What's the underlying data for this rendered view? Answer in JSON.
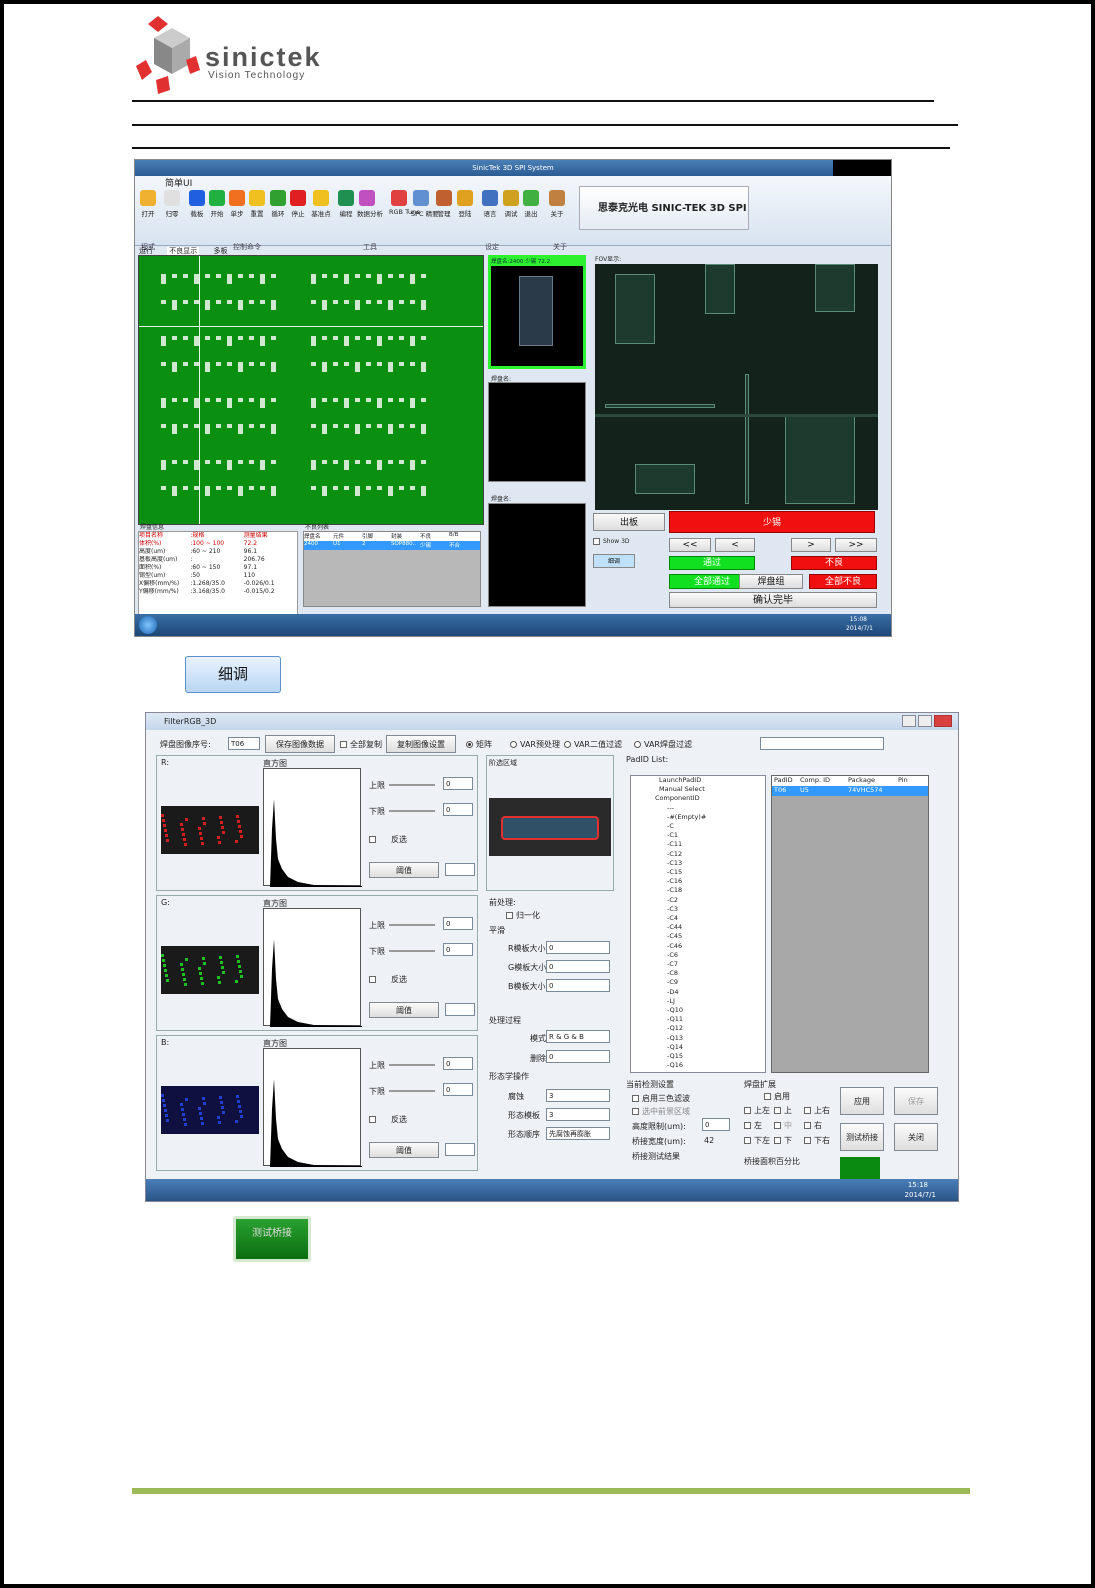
{
  "logo": {
    "name": "sinictek",
    "tagline": "Vision Technology"
  },
  "shot1": {
    "title": "SinicTek 3D SPI System",
    "tab_main": "简单UI",
    "ribbon_buttons": [
      "打开",
      "归零",
      "载板",
      "开始",
      "单步",
      "重置",
      "循环",
      "停止",
      "基准点",
      "编程",
      "数据分析",
      "RGB Tune",
      "SPC 精要",
      "管理",
      "登陆",
      "语言",
      "调试",
      "退出",
      "关于"
    ],
    "group_labels": [
      "程式",
      "控制命令",
      "工具",
      "",
      "设定",
      "关于"
    ],
    "brand_banner": "思泰克光电 SINIC-TEK 3D SPI",
    "tabs": [
      "运行",
      "不良显示",
      "多板"
    ],
    "thumb_label": "焊盘名:2400 少锡 72.2",
    "pad_name_label_1": "焊盘名:",
    "pad_name_label_2": "焊盘名:",
    "fov_label": "FOV显示:",
    "result_banner": "少锡",
    "exit_board": "出板",
    "show3d": "Show 3D",
    "detail": "细调",
    "nav": [
      "<<",
      "<",
      ">",
      ">>"
    ],
    "pass": "通过",
    "fail": "不良",
    "all_pass": "全部通过",
    "pad_group": "焊盘组",
    "all_fail": "全部不良",
    "confirm": "确认完毕",
    "pad_info_title": "焊盘信息",
    "pad_info_header": [
      "项目名称",
      ":规格",
      "测量结果"
    ],
    "pad_info_rows": [
      [
        "体积(%)",
        ":100 ~ 100",
        "72.2"
      ],
      [
        "高度(um)",
        ":60 ~ 210",
        "96.1"
      ],
      [
        "基板高度(um)",
        ":",
        "206.76"
      ],
      [
        "面积(%)",
        ":60 ~ 150",
        "97.1"
      ],
      [
        "锡型(um)",
        ":50",
        "110"
      ],
      [
        "X偏移(mm/%)",
        ":1.268/35.0",
        "-0.026/0.1"
      ],
      [
        "Y偏移(mm/%)",
        ":3.168/35.0",
        "-0.015/0.2"
      ]
    ],
    "defect_list_title": "不良列表",
    "defect_header": [
      "焊盘名",
      "元件",
      "引脚",
      "封装",
      "不良",
      "B/B"
    ],
    "defect_row": [
      "2400",
      "U1",
      "2",
      "SOP880..",
      "少锡",
      "不合"
    ],
    "clock": "15:08",
    "date": "2014/7/1"
  },
  "detail_button": "细调",
  "shot2": {
    "title": "FilterRGB_3D",
    "pad_index_label": "焊盘图像序号:",
    "pad_index": "T06",
    "save_data": "保存图像数据",
    "all_copy": "全部复制",
    "copy_settings": "复制图像设置",
    "radio": [
      "矩阵",
      "VAR预处理",
      "VAR二值过滤",
      "VAR焊盘过滤"
    ],
    "channels": [
      {
        "label": "R:",
        "hist": "直方图",
        "upper": "上限",
        "lower": "下限",
        "upper_val": "0",
        "lower_val": "0",
        "invert": "反选",
        "threshold": "阈值"
      },
      {
        "label": "G:",
        "hist": "直方图",
        "upper": "上限",
        "lower": "下限",
        "upper_val": "0",
        "lower_val": "0",
        "invert": "反选",
        "threshold": "阈值"
      },
      {
        "label": "B:",
        "hist": "直方图",
        "upper": "上限",
        "lower": "下限",
        "upper_val": "0",
        "lower_val": "0",
        "invert": "反选",
        "threshold": "阈值"
      }
    ],
    "result_label": "阶选区域",
    "preprocess": "前处理:",
    "normalize": "归一化",
    "smooth": "平滑",
    "smooth_rows": [
      {
        "label": "R模板大小",
        "value": "0"
      },
      {
        "label": "G模板大小",
        "value": "0"
      },
      {
        "label": "B模板大小",
        "value": "0"
      }
    ],
    "process": "处理过程",
    "mode_label": "模式",
    "mode_value": "R & G & B",
    "delete_label": "删除",
    "delete_value": "0",
    "morph": "形态学操作",
    "morph_rows": [
      {
        "label": "腐蚀",
        "value": "3"
      },
      {
        "label": "形态模板",
        "value": "3"
      },
      {
        "label": "形态顺序",
        "value": "先腐蚀再膨胀"
      }
    ],
    "padid_list": "PadID List:",
    "tree_items": [
      "LaunchPadID",
      "Manual Select",
      "ComponentID",
      "---",
      "-#(Empty)#",
      "-C",
      "-C1",
      "-C11",
      "-C12",
      "-C13",
      "-C15",
      "-C16",
      "-C18",
      "-C2",
      "-C3",
      "-C4",
      "-C44",
      "-C45",
      "-C46",
      "-C6",
      "-C7",
      "-C8",
      "-C9",
      "-D4",
      "-LJ",
      "-Q10",
      "-Q11",
      "-Q12",
      "-Q13",
      "-Q14",
      "-Q15",
      "-Q16",
      "-Q17",
      "-Q18"
    ],
    "grid_header": [
      "PadID",
      "Comp. ID",
      "Package",
      "Pin"
    ],
    "grid_row": [
      "T06",
      "U5",
      "74VHC574",
      ""
    ],
    "current_settings": "当前检测设置",
    "enable_3color": "启用三色滤波",
    "use_region": "选中前景区域",
    "height_limit": "高度限制(um):",
    "height_limit_val": "0",
    "bridge_width": "桥接宽度(um):",
    "bridge_width_val": "42",
    "bridge_result": "桥接测试结果",
    "pad_extend": "焊盘扩展",
    "enable": "启用",
    "dirs": [
      "上左",
      "上",
      "上右",
      "左",
      "中",
      "右",
      "下左",
      "下",
      "下右"
    ],
    "bridge_percent": "桥接面积百分比",
    "apply": "应用",
    "save": "保存",
    "test_bridge": "测试桥接",
    "close": "关闭",
    "clock": "15:18",
    "date": "2014/7/1"
  },
  "green_button": "测试桥接"
}
